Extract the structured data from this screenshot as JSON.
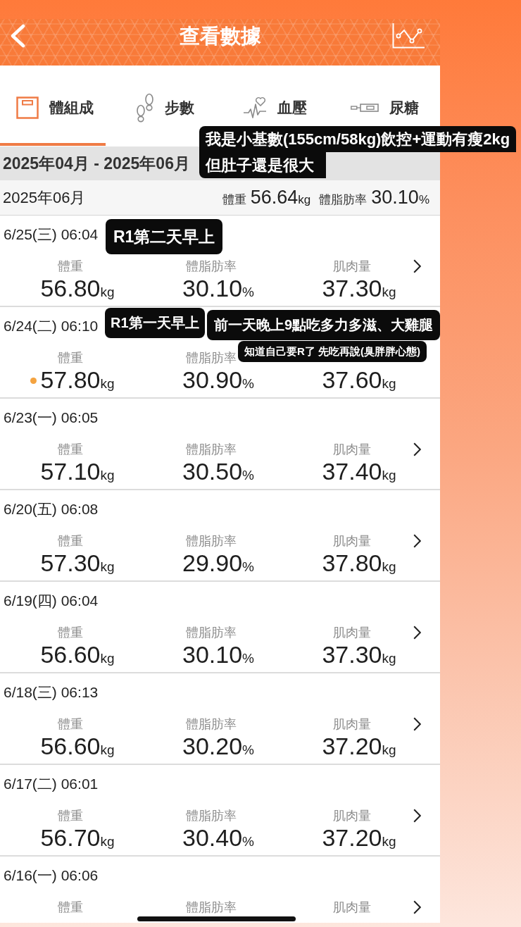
{
  "header": {
    "title": "查看數據"
  },
  "tabs": [
    {
      "label": "體組成",
      "selected": true
    },
    {
      "label": "步數",
      "selected": false
    },
    {
      "label": "血壓",
      "selected": false
    },
    {
      "label": "尿糖",
      "selected": false
    }
  ],
  "period": "2025年04月 - 2025年06月",
  "summary": {
    "month": "2025年06月",
    "items": [
      {
        "label": "體重",
        "value": "56.64",
        "unit": "kg"
      },
      {
        "label": "體脂肪率",
        "value": "30.10",
        "unit": "%"
      }
    ]
  },
  "records": [
    {
      "datetime": "6/25(三) 06:04",
      "marked": false,
      "arrow": true,
      "metrics": [
        {
          "label": "體重",
          "value": "56.80",
          "unit": "kg"
        },
        {
          "label": "體脂肪率",
          "value": "30.10",
          "unit": "%"
        },
        {
          "label": "肌肉量",
          "value": "37.30",
          "unit": "kg"
        }
      ]
    },
    {
      "datetime": "6/24(二) 06:10",
      "marked": true,
      "arrow": false,
      "metrics": [
        {
          "label": "體重",
          "value": "57.80",
          "unit": "kg"
        },
        {
          "label": "體脂肪率",
          "value": "30.90",
          "unit": "%"
        },
        {
          "value": "37.60",
          "unit": "kg"
        }
      ]
    },
    {
      "datetime": "6/23(一) 06:05",
      "marked": false,
      "arrow": true,
      "metrics": [
        {
          "label": "體重",
          "value": "57.10",
          "unit": "kg"
        },
        {
          "label": "體脂肪率",
          "value": "30.50",
          "unit": "%"
        },
        {
          "label": "肌肉量",
          "value": "37.40",
          "unit": "kg"
        }
      ]
    },
    {
      "datetime": "6/20(五) 06:08",
      "marked": false,
      "arrow": true,
      "metrics": [
        {
          "label": "體重",
          "value": "57.30",
          "unit": "kg"
        },
        {
          "label": "體脂肪率",
          "value": "29.90",
          "unit": "%"
        },
        {
          "label": "肌肉量",
          "value": "37.80",
          "unit": "kg"
        }
      ]
    },
    {
      "datetime": "6/19(四) 06:04",
      "marked": false,
      "arrow": true,
      "metrics": [
        {
          "label": "體重",
          "value": "56.60",
          "unit": "kg"
        },
        {
          "label": "體脂肪率",
          "value": "30.10",
          "unit": "%"
        },
        {
          "label": "肌肉量",
          "value": "37.30",
          "unit": "kg"
        }
      ]
    },
    {
      "datetime": "6/18(三) 06:13",
      "marked": false,
      "arrow": true,
      "metrics": [
        {
          "label": "體重",
          "value": "56.60",
          "unit": "kg"
        },
        {
          "label": "體脂肪率",
          "value": "30.20",
          "unit": "%"
        },
        {
          "label": "肌肉量",
          "value": "37.20",
          "unit": "kg"
        }
      ]
    },
    {
      "datetime": "6/17(二) 06:01",
      "marked": false,
      "arrow": true,
      "metrics": [
        {
          "label": "體重",
          "value": "56.70",
          "unit": "kg"
        },
        {
          "label": "體脂肪率",
          "value": "30.40",
          "unit": "%"
        },
        {
          "label": "肌肉量",
          "value": "37.20",
          "unit": "kg"
        }
      ]
    },
    {
      "datetime": "6/16(一) 06:06",
      "marked": false,
      "arrow": true,
      "metrics": [
        {
          "label": "體重"
        },
        {
          "label": "體脂肪率"
        },
        {
          "label": "肌肉量"
        }
      ]
    }
  ],
  "stickers": [
    {
      "text": "我是小基數(155cm/58kg)飲控+運動有瘦2kg\n但肚子還是很大"
    },
    {
      "text": "R1第二天早上"
    },
    {
      "text": "R1第一天早上"
    },
    {
      "text": "前一天晚上9點吃多力多滋、大雞腿"
    },
    {
      "text": "知道自己要R了 先吃再說(臭胖胖心態)"
    }
  ]
}
